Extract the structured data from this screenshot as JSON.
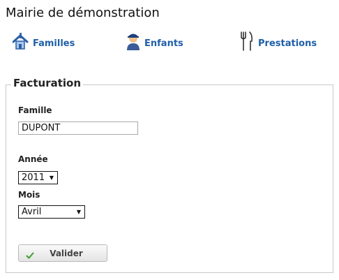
{
  "header": {
    "title": "Mairie de démonstration"
  },
  "nav": {
    "items": [
      {
        "label": "Familles",
        "icon": "house-icon"
      },
      {
        "label": "Enfants",
        "icon": "child-icon"
      },
      {
        "label": "Prestations",
        "icon": "fork-knife-icon"
      }
    ]
  },
  "form": {
    "legend": "Facturation",
    "famille": {
      "label": "Famille",
      "value": "DUPONT"
    },
    "annee": {
      "label": "Année",
      "selected": "2011"
    },
    "mois": {
      "label": "Mois",
      "selected": "Avril"
    },
    "submit_label": "Valider"
  },
  "colors": {
    "link": "#1f5fa8",
    "check": "#3aa02a"
  }
}
